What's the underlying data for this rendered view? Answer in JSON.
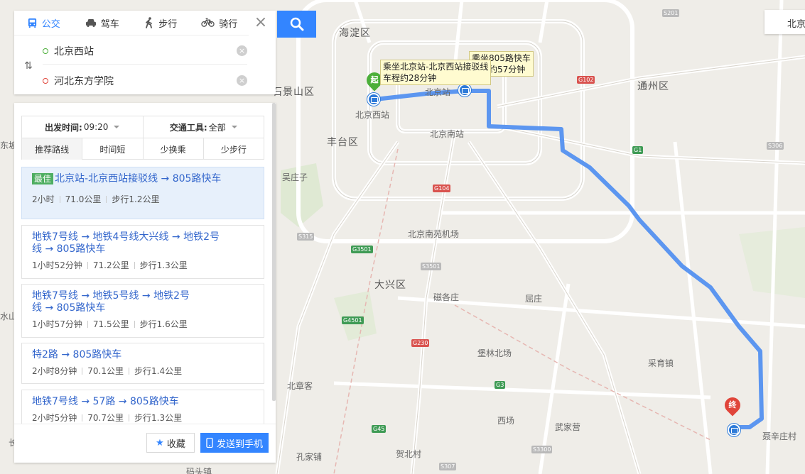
{
  "transport_modes": [
    {
      "label": "公交",
      "icon": "bus-icon",
      "active": true
    },
    {
      "label": "驾车",
      "icon": "car-icon",
      "active": false
    },
    {
      "label": "步行",
      "icon": "walk-icon",
      "active": false
    },
    {
      "label": "骑行",
      "icon": "bike-icon",
      "active": false
    }
  ],
  "search": {
    "origin": "北京西站",
    "destination": "河北东方学院",
    "close_label": "×"
  },
  "filters": {
    "depart_label": "出发时间:",
    "depart_value": "09:20",
    "vehicle_label": "交通工具:",
    "vehicle_value": "全部",
    "sort_options": [
      "推荐路线",
      "时间短",
      "少换乘",
      "少步行"
    ],
    "active_sort": "推荐路线"
  },
  "routes": [
    {
      "badge": "最佳",
      "line1": "北京站-北京西站接驳线 → 805路快车",
      "line2": "",
      "time": "2小时",
      "distance": "71.0公里",
      "walk": "步行1.2公里"
    },
    {
      "badge": "",
      "line1": "地铁7号线 → 地铁4号线大兴线 → 地铁2号",
      "line2": "线 → 805路快车",
      "time": "1小时52分钟",
      "distance": "71.2公里",
      "walk": "步行1.3公里"
    },
    {
      "badge": "",
      "line1": "地铁7号线 → 地铁5号线 → 地铁2号",
      "line2": "线 → 805路快车",
      "time": "1小时57分钟",
      "distance": "71.5公里",
      "walk": "步行1.6公里"
    },
    {
      "badge": "",
      "line1": "特2路 → 805路快车",
      "line2": "",
      "time": "2小时8分钟",
      "distance": "70.1公里",
      "walk": "步行1.4公里"
    },
    {
      "badge": "",
      "line1": "地铁7号线 → 57路 → 805路快车",
      "line2": "",
      "time": "2小时5分钟",
      "distance": "70.7公里",
      "walk": "步行1.3公里"
    }
  ],
  "actions": {
    "favorite_label": "收藏",
    "send_label": "发送到手机"
  },
  "city": "北京",
  "map": {
    "start_marker": "起",
    "end_marker": "终",
    "tooltip1_line1": "乘坐北京站-北京西站接驳线",
    "tooltip1_line2": "车程约28分钟",
    "tooltip2_line1": "乘坐805路快车",
    "tooltip2_line2": "车程约57分钟",
    "districts": [
      "海淀区",
      "石景山区",
      "丰台区",
      "通州区",
      "大兴区"
    ],
    "places": [
      "北京西站",
      "北京站",
      "北京南站",
      "北京南苑机场",
      "吴庄子",
      "磁各庄",
      "屈庄",
      "堡林北场",
      "采育镇",
      "北章客",
      "武家营",
      "西场",
      "孔家铺",
      "贺北村",
      "聂辛庄村",
      "码头镇",
      "东坡",
      "水山",
      "长"
    ],
    "road_shields": [
      "S201",
      "G102",
      "G1",
      "S306",
      "G104",
      "S315",
      "G3501",
      "G4501",
      "S3501",
      "G230",
      "G3",
      "S3300",
      "G45",
      "S307"
    ],
    "route_color": "#4f8ef0"
  }
}
